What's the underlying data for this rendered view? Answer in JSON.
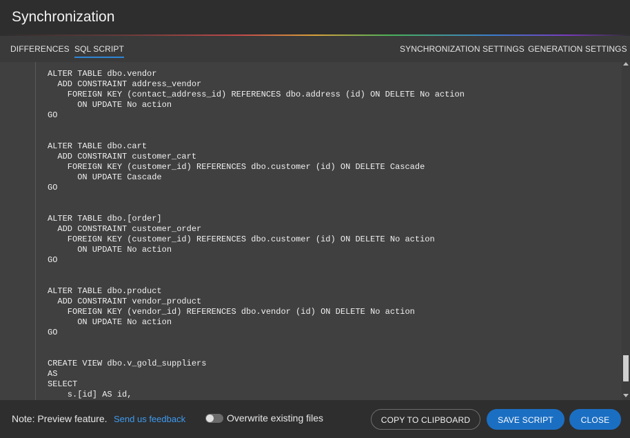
{
  "window": {
    "title": "Synchronization"
  },
  "tabs": {
    "left": [
      {
        "label": "DIFFERENCES",
        "active": false
      },
      {
        "label": "SQL SCRIPT",
        "active": true
      }
    ],
    "right": [
      {
        "label": "SYNCHRONIZATION SETTINGS"
      },
      {
        "label": "GENERATION SETTINGS"
      }
    ]
  },
  "script": {
    "lines": [
      "ALTER TABLE dbo.vendor",
      "  ADD CONSTRAINT address_vendor",
      "    FOREIGN KEY (contact_address_id) REFERENCES dbo.address (id) ON DELETE No action",
      "      ON UPDATE No action",
      "GO",
      "",
      "",
      "ALTER TABLE dbo.cart",
      "  ADD CONSTRAINT customer_cart",
      "    FOREIGN KEY (customer_id) REFERENCES dbo.customer (id) ON DELETE Cascade",
      "      ON UPDATE Cascade",
      "GO",
      "",
      "",
      "ALTER TABLE dbo.[order]",
      "  ADD CONSTRAINT customer_order",
      "    FOREIGN KEY (customer_id) REFERENCES dbo.customer (id) ON DELETE No action",
      "      ON UPDATE No action",
      "GO",
      "",
      "",
      "ALTER TABLE dbo.product",
      "  ADD CONSTRAINT vendor_product",
      "    FOREIGN KEY (vendor_id) REFERENCES dbo.vendor (id) ON DELETE No action",
      "      ON UPDATE No action",
      "GO",
      "",
      "",
      "CREATE VIEW dbo.v_gold_suppliers",
      "AS",
      "SELECT",
      "    s.[id] AS id,"
    ]
  },
  "footer": {
    "note": "Note: Preview feature.",
    "feedback_link": "Send us feedback",
    "toggle_label": "Overwrite existing files",
    "toggle_on": false,
    "copy_button": "COPY TO CLIPBOARD",
    "save_button": "SAVE SCRIPT",
    "close_button": "CLOSE"
  },
  "colors": {
    "accent": "#1b6fc3",
    "link": "#3e9bf0",
    "tab_underline": "#2f86d6",
    "background": "#404040",
    "chrome": "#2e2e2e"
  }
}
